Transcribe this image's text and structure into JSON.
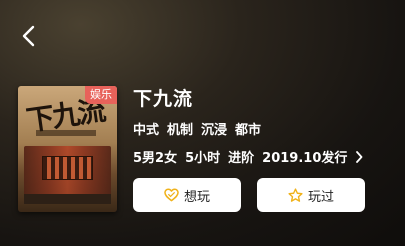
{
  "nav": {
    "back_icon": "chevron-left-icon"
  },
  "game": {
    "cover_title": "下九流",
    "badge": "娱乐",
    "title": "下九流",
    "tags": [
      "中式",
      "机制",
      "沉浸",
      "都市"
    ],
    "meta": [
      "5男2女",
      "5小时",
      "进阶",
      "2019.10发行"
    ]
  },
  "actions": {
    "want": {
      "label": "想玩",
      "icon": "heart-icon"
    },
    "played": {
      "label": "玩过",
      "icon": "star-icon"
    }
  },
  "colors": {
    "badge": "#e8625a",
    "icon_accent": "#f0b21a",
    "button_bg": "#ffffff"
  }
}
